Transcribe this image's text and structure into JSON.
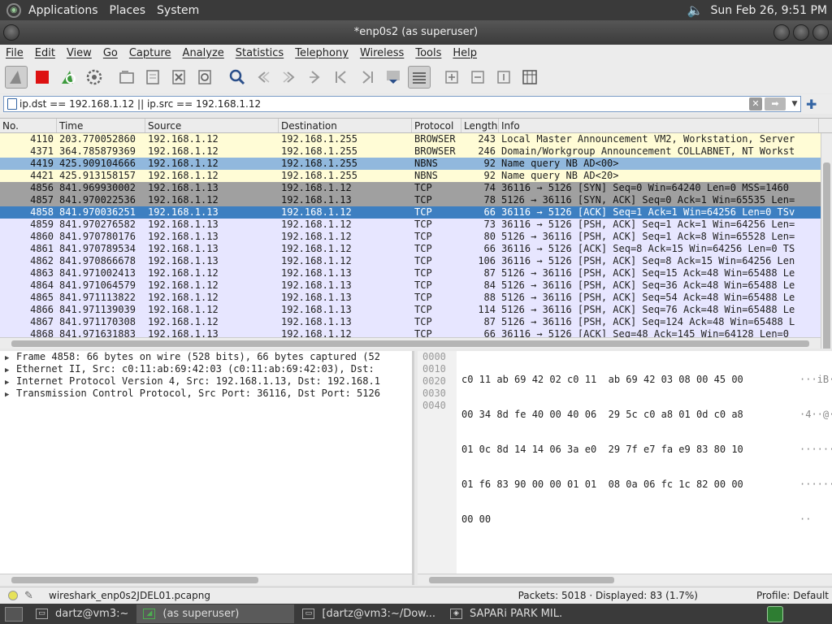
{
  "top_panel": {
    "menus": [
      "Applications",
      "Places",
      "System"
    ],
    "clock": "Sun Feb 26,  9:51 PM"
  },
  "window": {
    "title": "*enp0s2 (as superuser)"
  },
  "menu_bar": [
    "File",
    "Edit",
    "View",
    "Go",
    "Capture",
    "Analyze",
    "Statistics",
    "Telephony",
    "Wireless",
    "Tools",
    "Help"
  ],
  "filter": {
    "value": "ip.dst == 192.168.1.12 || ip.src == 192.168.1.12"
  },
  "packet_list": {
    "columns": [
      "No.",
      "Time",
      "Source",
      "Destination",
      "Protocol",
      "Length",
      "Info"
    ],
    "rows": [
      {
        "no": "4110",
        "time": "203.770052860",
        "src": "192.168.1.12",
        "dst": "192.168.1.255",
        "proto": "BROWSER",
        "len": "243",
        "info": "Local Master Announcement VM2, Workstation, Server"
      },
      {
        "no": "4371",
        "time": "364.785879369",
        "src": "192.168.1.12",
        "dst": "192.168.1.255",
        "proto": "BROWSER",
        "len": "246",
        "info": "Domain/Workgroup Announcement COLLABNET, NT Workst"
      },
      {
        "no": "4419",
        "time": "425.909104666",
        "src": "192.168.1.12",
        "dst": "192.168.1.255",
        "proto": "NBNS",
        "len": "92",
        "info": "Name query NB AD<00>"
      },
      {
        "no": "4421",
        "time": "425.913158157",
        "src": "192.168.1.12",
        "dst": "192.168.1.255",
        "proto": "NBNS",
        "len": "92",
        "info": "Name query NB AD<20>"
      },
      {
        "no": "4856",
        "time": "841.969930002",
        "src": "192.168.1.13",
        "dst": "192.168.1.12",
        "proto": "TCP",
        "len": "74",
        "info": "36116 → 5126 [SYN] Seq=0 Win=64240 Len=0 MSS=1460"
      },
      {
        "no": "4857",
        "time": "841.970022536",
        "src": "192.168.1.12",
        "dst": "192.168.1.13",
        "proto": "TCP",
        "len": "78",
        "info": "5126 → 36116 [SYN, ACK] Seq=0 Ack=1 Win=65535 Len="
      },
      {
        "no": "4858",
        "time": "841.970036251",
        "src": "192.168.1.13",
        "dst": "192.168.1.12",
        "proto": "TCP",
        "len": "66",
        "info": "36116 → 5126 [ACK] Seq=1 Ack=1 Win=64256 Len=0 TSv"
      },
      {
        "no": "4859",
        "time": "841.970276582",
        "src": "192.168.1.13",
        "dst": "192.168.1.12",
        "proto": "TCP",
        "len": "73",
        "info": "36116 → 5126 [PSH, ACK] Seq=1 Ack=1 Win=64256 Len="
      },
      {
        "no": "4860",
        "time": "841.970780176",
        "src": "192.168.1.13",
        "dst": "192.168.1.12",
        "proto": "TCP",
        "len": "80",
        "info": "5126 → 36116 [PSH, ACK] Seq=1 Ack=8 Win=65528 Len="
      },
      {
        "no": "4861",
        "time": "841.970789534",
        "src": "192.168.1.13",
        "dst": "192.168.1.12",
        "proto": "TCP",
        "len": "66",
        "info": "36116 → 5126 [ACK] Seq=8 Ack=15 Win=64256 Len=0 TS"
      },
      {
        "no": "4862",
        "time": "841.970866678",
        "src": "192.168.1.13",
        "dst": "192.168.1.12",
        "proto": "TCP",
        "len": "106",
        "info": "36116 → 5126 [PSH, ACK] Seq=8 Ack=15 Win=64256 Len"
      },
      {
        "no": "4863",
        "time": "841.971002413",
        "src": "192.168.1.12",
        "dst": "192.168.1.13",
        "proto": "TCP",
        "len": "87",
        "info": "5126 → 36116 [PSH, ACK] Seq=15 Ack=48 Win=65488 Le"
      },
      {
        "no": "4864",
        "time": "841.971064579",
        "src": "192.168.1.12",
        "dst": "192.168.1.13",
        "proto": "TCP",
        "len": "84",
        "info": "5126 → 36116 [PSH, ACK] Seq=36 Ack=48 Win=65488 Le"
      },
      {
        "no": "4865",
        "time": "841.971113822",
        "src": "192.168.1.12",
        "dst": "192.168.1.13",
        "proto": "TCP",
        "len": "88",
        "info": "5126 → 36116 [PSH, ACK] Seq=54 Ack=48 Win=65488 Le"
      },
      {
        "no": "4866",
        "time": "841.971139039",
        "src": "192.168.1.12",
        "dst": "192.168.1.13",
        "proto": "TCP",
        "len": "114",
        "info": "5126 → 36116 [PSH, ACK] Seq=76 Ack=48 Win=65488 Le"
      },
      {
        "no": "4867",
        "time": "841.971170308",
        "src": "192.168.1.12",
        "dst": "192.168.1.13",
        "proto": "TCP",
        "len": "87",
        "info": "5126 → 36116 [PSH, ACK] Seq=124 Ack=48 Win=65488 L"
      },
      {
        "no": "4868",
        "time": "841.971631883",
        "src": "192.168.1.13",
        "dst": "192.168.1.12",
        "proto": "TCP",
        "len": "66",
        "info": "36116 → 5126 [ACK] Seq=48 Ack=145 Win=64128 Len=0"
      }
    ]
  },
  "details": [
    "Frame 4858: 66 bytes on wire (528 bits), 66 bytes captured (52",
    "Ethernet II, Src: c0:11:ab:69:42:03 (c0:11:ab:69:42:03), Dst: ",
    "Internet Protocol Version 4, Src: 192.168.1.13, Dst: 192.168.1",
    "Transmission Control Protocol, Src Port: 36116, Dst Port: 5126"
  ],
  "bytes": {
    "offsets": [
      "0000",
      "0010",
      "0020",
      "0030",
      "0040"
    ],
    "hex": [
      "c0 11 ab 69 42 02 c0 11  ab 69 42 03 08 00 45 00",
      "00 34 8d fe 40 00 40 06  29 5c c0 a8 01 0d c0 a8",
      "01 0c 8d 14 14 06 3a e0  29 7f e7 fa e9 83 80 10",
      "01 f6 83 90 00 00 01 01  08 0a 06 fc 1c 82 00 00",
      "00 00"
    ],
    "ascii": [
      "···iB···",
      "·4··@·@·",
      "······:·",
      "········",
      "··"
    ]
  },
  "status_bar": {
    "file": "wireshark_enp0s2JDEL01.pcapng",
    "packets": "Packets: 5018 · Displayed: 83 (1.7%)",
    "profile": "Profile: Default"
  },
  "taskbar": {
    "tasks": [
      "dartz@vm3:~",
      "(as superuser)",
      "[dartz@vm3:~/Dow...",
      "SAPARi PARK MIL."
    ]
  },
  "colors": {
    "row_yellow": "#fffcd6",
    "row_gray": "#a0a0a0",
    "row_lavender": "#e7e6ff",
    "row_selected": "#3d7fc1",
    "row_selected_light": "#91b8dd"
  }
}
